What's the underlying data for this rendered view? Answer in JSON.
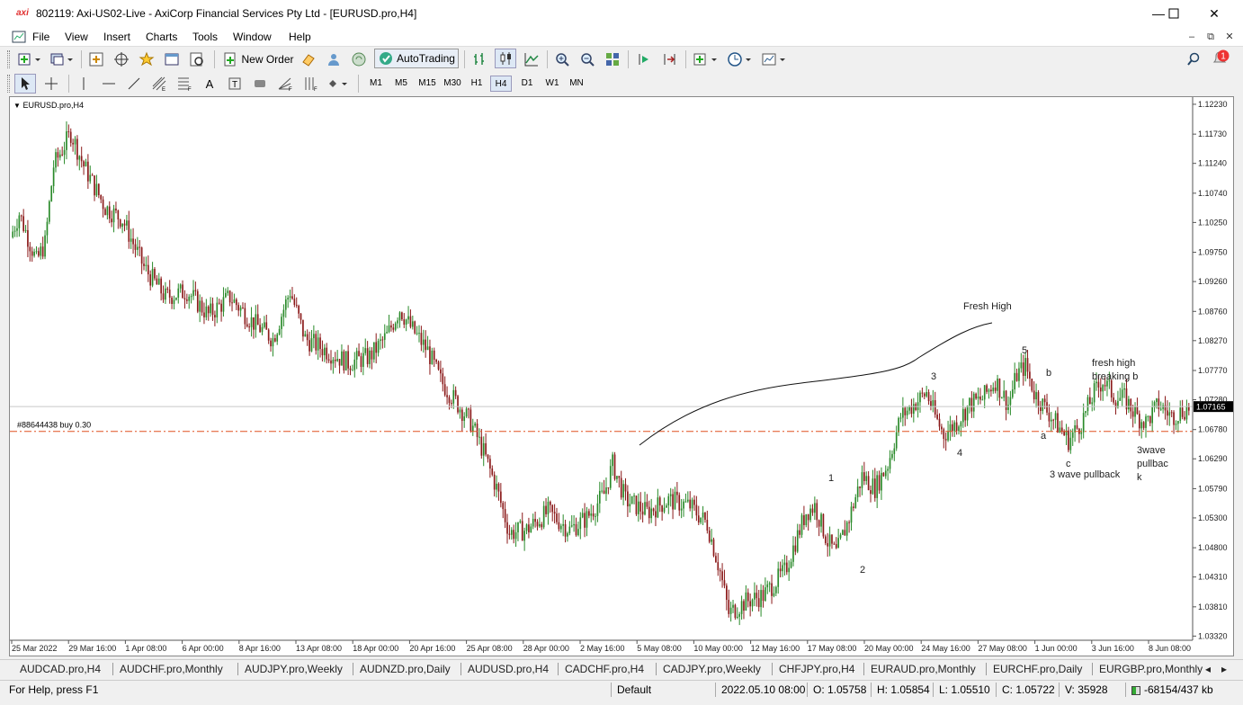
{
  "window": {
    "logo": "axi",
    "title": "802119: Axi-US02-Live - AxiCorp Financial Services Pty Ltd - [EURUSD.pro,H4]"
  },
  "menu": [
    "File",
    "View",
    "Insert",
    "Charts",
    "Tools",
    "Window",
    "Help"
  ],
  "toolbar": {
    "new_order": "New Order",
    "autotrading": "AutoTrading",
    "alert_count": "1"
  },
  "timeframes": [
    "M1",
    "M5",
    "M15",
    "M30",
    "H1",
    "H4",
    "D1",
    "W1",
    "MN"
  ],
  "active_timeframe": "H4",
  "chart": {
    "symbol_label": "EURUSD.pro,H4",
    "order_line_label": "#88644438 buy 0.30",
    "current_price": "1.07165",
    "order_price": 1.0675,
    "colors": {
      "bull": "#2a8a2a",
      "bear": "#8b1a1a",
      "order_line": "#e05020",
      "price_line": "#c8c8c8",
      "price_box": "#000000"
    }
  },
  "annotations": [
    "Fresh High",
    "5",
    "b",
    "3",
    "fresh high",
    "breaking b",
    "4",
    "a",
    "c",
    "3 wave pullback",
    "3wave",
    "pullbac",
    "k",
    "1",
    "2"
  ],
  "chart_data": {
    "type": "candlestick",
    "title": "",
    "ylim": [
      1.0325,
      1.1235
    ],
    "y_ticks": [
      "1.12230",
      "1.11730",
      "1.11240",
      "1.10740",
      "1.10250",
      "1.09750",
      "1.09260",
      "1.08760",
      "1.08270",
      "1.07770",
      "1.07280",
      "1.06780",
      "1.06290",
      "1.05790",
      "1.05300",
      "1.04800",
      "1.04310",
      "1.03810",
      "1.03320"
    ],
    "x_ticks": [
      "25 Mar 2022",
      "29 Mar 16:00",
      "1 Apr 08:00",
      "6 Apr 00:00",
      "8 Apr 16:00",
      "13 Apr 08:00",
      "18 Apr 00:00",
      "20 Apr 16:00",
      "25 Apr 08:00",
      "28 Apr 00:00",
      "2 May 16:00",
      "5 May 08:00",
      "10 May 00:00",
      "12 May 16:00",
      "17 May 08:00",
      "20 May 00:00",
      "24 May 16:00",
      "27 May 08:00",
      "1 Jun 00:00",
      "3 Jun 16:00",
      "8 Jun 08:00"
    ],
    "price_path": [
      [
        0,
        1.1
      ],
      [
        4,
        1.104
      ],
      [
        12,
        1.096
      ],
      [
        16,
        1.099
      ],
      [
        20,
        1.112
      ],
      [
        28,
        1.1175
      ],
      [
        34,
        1.112
      ],
      [
        44,
        1.105
      ],
      [
        52,
        1.103
      ],
      [
        62,
        1.095
      ],
      [
        72,
        1.09
      ],
      [
        82,
        1.091
      ],
      [
        92,
        1.087
      ],
      [
        102,
        1.09
      ],
      [
        112,
        1.086
      ],
      [
        122,
        1.083
      ],
      [
        130,
        1.091
      ],
      [
        137,
        1.083
      ],
      [
        147,
        1.081
      ],
      [
        157,
        1.079
      ],
      [
        167,
        1.08
      ],
      [
        175,
        1.0835
      ],
      [
        181,
        1.088
      ],
      [
        186,
        1.085
      ],
      [
        194,
        1.081
      ],
      [
        200,
        1.076
      ],
      [
        208,
        1.072
      ],
      [
        214,
        1.069
      ],
      [
        220,
        1.064
      ],
      [
        226,
        1.058
      ],
      [
        232,
        1.0505
      ],
      [
        240,
        1.051
      ],
      [
        250,
        1.054
      ],
      [
        260,
        1.051
      ],
      [
        268,
        1.053
      ],
      [
        276,
        1.057
      ],
      [
        280,
        1.062
      ],
      [
        286,
        1.056
      ],
      [
        296,
        1.054
      ],
      [
        306,
        1.056
      ],
      [
        316,
        1.055
      ],
      [
        324,
        1.052
      ],
      [
        330,
        1.044
      ],
      [
        334,
        1.037
      ],
      [
        342,
        1.039
      ],
      [
        350,
        1.04
      ],
      [
        360,
        1.044
      ],
      [
        366,
        1.05
      ],
      [
        370,
        1.054
      ],
      [
        374,
        1.055
      ],
      [
        380,
        1.049
      ],
      [
        384,
        1.047
      ],
      [
        390,
        1.053
      ],
      [
        396,
        1.06
      ],
      [
        402,
        1.058
      ],
      [
        408,
        1.062
      ],
      [
        414,
        1.07
      ],
      [
        420,
        1.072
      ],
      [
        426,
        1.074
      ],
      [
        430,
        1.07
      ],
      [
        434,
        1.067
      ],
      [
        440,
        1.069
      ],
      [
        446,
        1.072
      ],
      [
        452,
        1.073
      ],
      [
        458,
        1.076
      ],
      [
        464,
        1.072
      ],
      [
        468,
        1.077
      ],
      [
        472,
        1.0785
      ],
      [
        476,
        1.074
      ],
      [
        480,
        1.072
      ],
      [
        486,
        1.069
      ],
      [
        492,
        1.066
      ],
      [
        498,
        1.069
      ],
      [
        504,
        1.074
      ],
      [
        508,
        1.076
      ],
      [
        514,
        1.073
      ],
      [
        518,
        1.073
      ],
      [
        524,
        1.07
      ],
      [
        528,
        1.069
      ],
      [
        534,
        1.072
      ],
      [
        540,
        1.07
      ],
      [
        548,
        1.0715
      ]
    ],
    "candle_count": 548
  },
  "symbol_tabs": [
    "AUDCAD.pro,H4",
    "AUDCHF.pro,Monthly",
    "AUDJPY.pro,Weekly",
    "AUDNZD.pro,Daily",
    "AUDUSD.pro,H4",
    "CADCHF.pro,H4",
    "CADJPY.pro,Weekly",
    "CHFJPY.pro,H4",
    "EURAUD.pro,Monthly",
    "EURCHF.pro,Daily",
    "EURGBP.pro,Monthly"
  ],
  "status": {
    "help": "For Help, press F1",
    "profile": "Default",
    "datetime": "2022.05.10 08:00",
    "open": "O: 1.05758",
    "high": "H: 1.05854",
    "low": "L: 1.05510",
    "close": "C: 1.05722",
    "volume": "V: 35928",
    "traffic": "-68154/437 kb"
  }
}
